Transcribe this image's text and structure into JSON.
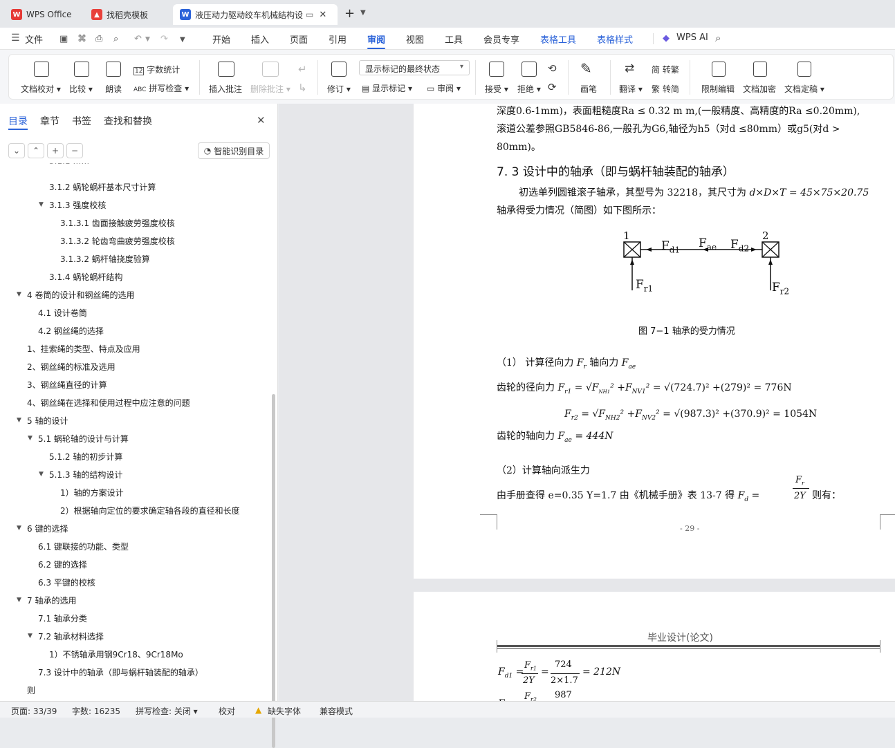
{
  "tabs": [
    {
      "label": "WPS Office"
    },
    {
      "label": "找稻壳模板"
    },
    {
      "label": "液压动力驱动绞车机械结构设"
    }
  ],
  "menu": {
    "file": "文件",
    "items": [
      "开始",
      "插入",
      "页面",
      "引用",
      "审阅",
      "视图",
      "工具",
      "会员专享"
    ],
    "selected": "审阅",
    "table_tools": "表格工具",
    "table_style": "表格样式",
    "ai": "WPS AI"
  },
  "ribbon": {
    "doc_check": "文档校对",
    "compare": "比较",
    "read_aloud": "朗读",
    "word_count": "字数统计",
    "spell_check": "拼写检查",
    "insert_comment": "插入批注",
    "delete_comment": "删除批注",
    "revise": "修订",
    "markup_state": "显示标记的最终状态",
    "show_markup": "显示标记",
    "review": "审阅",
    "accept": "接受",
    "reject": "拒绝",
    "pen": "画笔",
    "translate": "翻译",
    "to_trad": "简 转繁",
    "to_simp": "繁 转简",
    "restrict": "限制编辑",
    "encrypt": "文档加密",
    "finalize": "文档定稿"
  },
  "panel": {
    "tabs": [
      "目录",
      "章节",
      "书签",
      "查找和替换"
    ],
    "smart_toc": "智能识别目录",
    "toc": [
      "3.1.2 蜗轮蜗杆基本尺寸计算",
      "3.1.3 强度校核",
      "3.1.3.1 齿面接触疲劳强度校核",
      "3.1.3.2 轮齿弯曲疲劳强度校核",
      "3.1.3.2 蜗杆轴挠度验算",
      "3.1.4 蜗轮蜗杆结构",
      "4  卷筒的设计和钢丝绳的选用",
      "4.1 设计卷筒",
      "4.2 钢丝绳的选择",
      "1、挂索绳的类型、特点及应用",
      "2、钢丝绳的标准及选用",
      "3、钢丝绳直径的计算",
      "4、钢丝绳在选择和使用过程中应注意的问题",
      "5  轴的设计",
      "5.1 蜗轮轴的设计与计算",
      "5.1.2 轴的初步计算",
      "5.1.3 轴的结构设计",
      "1）轴的方案设计",
      "2）根据轴向定位的要求确定轴各段的直径和长度",
      "6  键的选择",
      "6.1 键联接的功能、类型",
      "6.2 键的选择",
      "6.3 平键的校核",
      "7  轴承的选用",
      "7.1 轴承分类",
      "7.2 轴承材料选择",
      "1）不锈轴承用钢9Cr18、9Cr18Mo",
      "7.3 设计中的轴承（即与蜗杆轴装配的轴承）",
      "则"
    ]
  },
  "doc": {
    "line1": "深度0.6-1mm)，表面粗糙度Ra  ≤  0.32 m m,(一般精度、高精度的Ra  ≤0.20mm),",
    "line2": "滚道公差参照GB5846-86,一般孔为G6,轴径为h5（对d  ≤80mm）或g5(对d  >",
    "line3": "80mm)。",
    "heading": "7. 3 设计中的轴承（即与蜗杆轴装配的轴承）",
    "para1": "初选单列圆锥滚子轴承，其型号为 32218，其尺寸为",
    "para1_math": "d×D×T = 45×75×20.75",
    "para2": "轴承得受力情况（简图）如下图所示：",
    "fig_caption": "图 7−1  轴承的受力情况",
    "fig": {
      "n1": "1",
      "n2": "2",
      "fd1": "F",
      "fd1_sub": "d1",
      "fae": "F",
      "fae_sub": "ae",
      "fd2": "F",
      "fd2_sub": "d2",
      "fr1": "F",
      "fr1_sub": "r1",
      "fr2": "F",
      "fr2_sub": "r2"
    },
    "s1": "（1）  计算径向力",
    "s1_b": "轴向力",
    "eq_radial_label": "齿轮的径向力",
    "eq1": "= √(724.7)² +(279)²  = 776N",
    "eq2": "= √(987.3)² +(370.9)²  = 1054N",
    "axial_label": "齿轮的轴向力",
    "axial_val": "= 444N",
    "s2": "（2）计算轴向派生力",
    "s2_text": "由手册查得 e=0.35      Y=1.7      由《机械手册》表 13-7 得",
    "s2_end": "则有：",
    "page_num": "- 29 -",
    "header2": "毕业设计(论文)",
    "eq3_val": "= 212N",
    "eq3_num": "724",
    "eq3_den": "2×1.7",
    "eq4_num": "987"
  },
  "status": {
    "page": "页面: 33/39",
    "words": "字数: 16235",
    "spell": "拼写检查: 关闭",
    "proof": "校对",
    "missing_font": "缺失字体",
    "compat": "兼容模式"
  }
}
